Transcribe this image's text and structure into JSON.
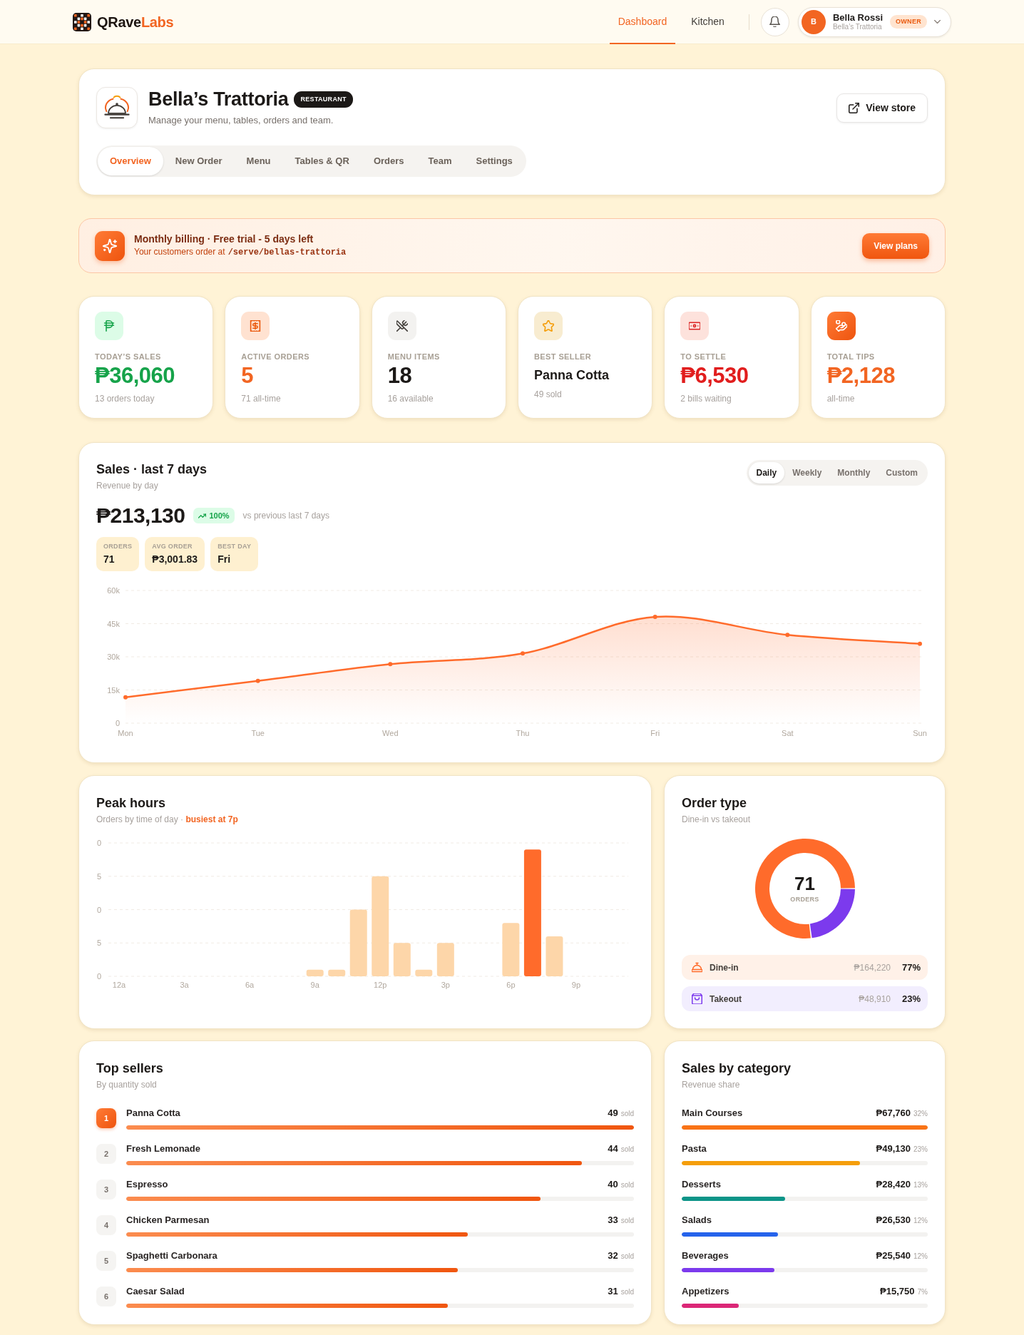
{
  "brand": {
    "name": "QRave",
    "accent": "Labs"
  },
  "nav": [
    {
      "label": "Dashboard",
      "selected": true
    },
    {
      "label": "Kitchen",
      "selected": false
    }
  ],
  "user": {
    "initial": "B",
    "name": "Bella Rossi",
    "store": "Bella’s Trattoria",
    "role": "OWNER"
  },
  "store": {
    "name": "Bella’s Trattoria",
    "type": "RESTAURANT",
    "description": "Manage your menu, tables, orders and team.",
    "action": "View store",
    "tabs": [
      {
        "label": "Overview",
        "selected": true
      },
      {
        "label": "New Order",
        "selected": false
      },
      {
        "label": "Menu",
        "selected": false
      },
      {
        "label": "Tables & QR",
        "selected": false
      },
      {
        "label": "Orders",
        "selected": false
      },
      {
        "label": "Team",
        "selected": false
      },
      {
        "label": "Settings",
        "selected": false
      }
    ]
  },
  "banner": {
    "title": "Monthly billing · Free trial - 5 days left",
    "text": "Your customers order at",
    "path": "/serve/bellas-trattoria",
    "action": "View plans"
  },
  "stats": [
    {
      "kind": "sales",
      "label": "TODAY’S SALES",
      "value": "₱36,060",
      "note": "13 orders today",
      "color": "#16a34a"
    },
    {
      "kind": "orders",
      "label": "ACTIVE ORDERS",
      "value": "5",
      "note": "71 all-time",
      "color": "#f26522"
    },
    {
      "kind": "menu",
      "label": "MENU ITEMS",
      "value": "18",
      "note": "16 available",
      "color": "#1c1917"
    },
    {
      "kind": "bestseller",
      "label": "BEST SELLER",
      "value": "Panna Cotta",
      "note": "49 sold",
      "color": "#1c1917"
    },
    {
      "kind": "settle",
      "label": "TO SETTLE",
      "value": "₱6,530",
      "note": "2 bills waiting",
      "color": "#e11d1d"
    },
    {
      "kind": "tips",
      "label": "TOTAL TIPS",
      "value": "₱2,128",
      "note": "all-time",
      "color": "#f26522"
    }
  ],
  "sales": {
    "title": "Sales · last 7 days",
    "subtitle": "Revenue by day",
    "ranges": [
      {
        "label": "Daily",
        "selected": true
      },
      {
        "label": "Weekly",
        "selected": false
      },
      {
        "label": "Monthly",
        "selected": false
      },
      {
        "label": "Custom",
        "selected": false
      }
    ],
    "total": "₱213,130",
    "change": "100%",
    "comparison": "vs previous last 7 days",
    "metrics": [
      {
        "label": "ORDERS",
        "value": "71"
      },
      {
        "label": "AVG ORDER",
        "value": "₱3,001.83"
      },
      {
        "label": "BEST DAY",
        "value": "Fri"
      }
    ],
    "chart_data": {
      "type": "area",
      "categories": [
        "Mon",
        "Tue",
        "Wed",
        "Thu",
        "Fri",
        "Sat",
        "Sun"
      ],
      "values": [
        11700,
        19100,
        26700,
        31500,
        48100,
        39900,
        35900
      ],
      "ylim": [
        0,
        60000
      ],
      "yticks": [
        {
          "value": 0,
          "label": "0"
        },
        {
          "value": 15000,
          "label": "15k"
        },
        {
          "value": 30000,
          "label": "30k"
        },
        {
          "value": 45000,
          "label": "45k"
        },
        {
          "value": 60000,
          "label": "60k"
        }
      ],
      "grid": true
    }
  },
  "peak_hours": {
    "title": "Peak hours",
    "subtitle": "Orders by time of day · **busiest at 7p**",
    "cut_axis_labels": [
      "0",
      "5",
      "0"
    ],
    "chart_data": {
      "type": "bar",
      "categories": [
        "12a",
        null,
        null,
        "3a",
        null,
        null,
        "6a",
        null,
        null,
        "9a",
        null,
        null,
        "12p",
        null,
        null,
        "3p",
        null,
        null,
        "6p",
        null,
        null,
        "9p",
        null,
        null
      ],
      "values": [
        0,
        0,
        0,
        0,
        0,
        0,
        0,
        0,
        0,
        1,
        1,
        10,
        15,
        5,
        1,
        5,
        0,
        0,
        8,
        19,
        6,
        0,
        0,
        0
      ],
      "ylim": [
        0,
        20
      ],
      "yticks": [
        {
          "value": 0,
          "label": "0"
        },
        {
          "value": 5,
          "label": "5"
        }
      ],
      "grid": true
    }
  },
  "order_type": {
    "title": "Order type",
    "subtitle": "Dine-in vs takeout",
    "total": "71",
    "total_label": "ORDERS",
    "chart_data": {
      "type": "donut",
      "values": [
        77,
        23
      ]
    },
    "legend": [
      {
        "kind": "dine-in",
        "label": "Dine-in",
        "amount": "₱164,220",
        "share": "77%",
        "color": "#ff6b2b"
      },
      {
        "kind": "takeout",
        "label": "Takeout",
        "amount": "₱48,910",
        "share": "23%",
        "color": "#7c3aed"
      }
    ]
  },
  "top_sellers": {
    "title": "Top sellers",
    "subtitle": "By quantity sold",
    "items": [
      {
        "rank": "1",
        "name": "Panna Cotta",
        "count": "49",
        "unit": "sold",
        "level": 1,
        "highlighted": true
      },
      {
        "rank": "2",
        "name": "Fresh Lemonade",
        "count": "44",
        "unit": "sold",
        "level": 0.898,
        "highlighted": false
      },
      {
        "rank": "3",
        "name": "Espresso",
        "count": "40",
        "unit": "sold",
        "level": 0.816,
        "highlighted": false
      },
      {
        "rank": "4",
        "name": "Chicken Parmesan",
        "count": "33",
        "unit": "sold",
        "level": 0.673,
        "highlighted": false
      },
      {
        "rank": "5",
        "name": "Spaghetti Carbonara",
        "count": "32",
        "unit": "sold",
        "level": 0.653,
        "highlighted": false
      },
      {
        "rank": "6",
        "name": "Caesar Salad",
        "count": "31",
        "unit": "sold",
        "level": 0.633,
        "highlighted": false
      }
    ]
  },
  "categories": {
    "title": "Sales by category",
    "subtitle": "Revenue share",
    "items": [
      {
        "name": "Main Courses",
        "amount": "₱67,760",
        "share": "32%",
        "level": 1,
        "color": "#f97316"
      },
      {
        "name": "Pasta",
        "amount": "₱49,130",
        "share": "23%",
        "level": 0.725,
        "color": "#f59e0b"
      },
      {
        "name": "Desserts",
        "amount": "₱28,420",
        "share": "13%",
        "level": 0.419,
        "color": "#0d9488"
      },
      {
        "name": "Salads",
        "amount": "₱26,530",
        "share": "12%",
        "level": 0.392,
        "color": "#2563eb"
      },
      {
        "name": "Beverages",
        "amount": "₱25,540",
        "share": "12%",
        "level": 0.377,
        "color": "#7c3aed"
      },
      {
        "name": "Appetizers",
        "amount": "₱15,750",
        "share": "7%",
        "level": 0.232,
        "color": "#db2777"
      }
    ]
  }
}
